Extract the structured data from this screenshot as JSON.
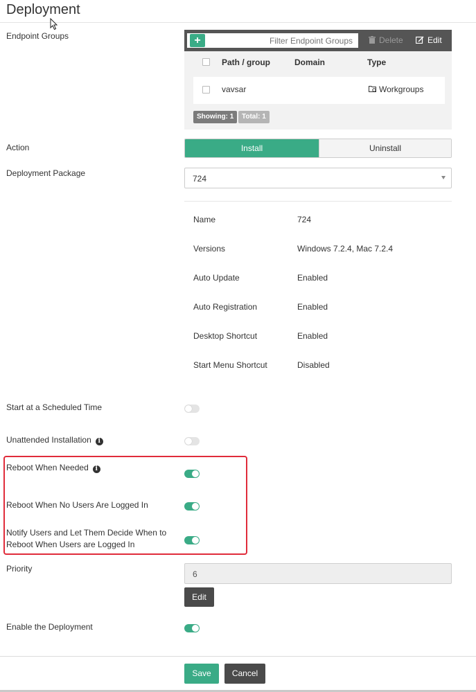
{
  "page": {
    "title": "Deployment"
  },
  "labels": {
    "endpoint_groups": "Endpoint Groups",
    "action": "Action",
    "deployment_package": "Deployment Package",
    "start_scheduled": "Start at a Scheduled Time",
    "unattended": "Unattended Installation",
    "reboot_needed": "Reboot When Needed",
    "reboot_no_users": "Reboot When No Users Are Logged In",
    "notify_line1": "Notify Users and Let Them Decide When to",
    "notify_line2": "Reboot When Users are Logged In",
    "priority": "Priority",
    "enable": "Enable the Deployment"
  },
  "endpoint_groups": {
    "add_label": "+",
    "filter_placeholder": "Filter Endpoint Groups",
    "delete_label": "Delete",
    "edit_label": "Edit",
    "columns": [
      "Path / group",
      "Domain",
      "Type"
    ],
    "rows": [
      {
        "path": "vavsar",
        "domain": "",
        "type": "Workgroups"
      }
    ],
    "showing": "Showing: 1",
    "total": "Total: 1"
  },
  "action": {
    "options": [
      "Install",
      "Uninstall"
    ],
    "selected": "Install"
  },
  "package": {
    "selected": "724",
    "details": [
      {
        "key": "Name",
        "value": "724"
      },
      {
        "key": "Versions",
        "value": "Windows 7.2.4, Mac 7.2.4"
      },
      {
        "key": "Auto Update",
        "value": "Enabled"
      },
      {
        "key": "Auto Registration",
        "value": "Enabled"
      },
      {
        "key": "Desktop Shortcut",
        "value": "Enabled"
      },
      {
        "key": "Start Menu Shortcut",
        "value": "Disabled"
      }
    ]
  },
  "toggles": {
    "start_scheduled": false,
    "unattended": false,
    "reboot_needed": true,
    "reboot_no_users": true,
    "notify_users": true,
    "enable": true
  },
  "priority": {
    "value": "6",
    "edit_label": "Edit"
  },
  "footer": {
    "save_label": "Save",
    "cancel_label": "Cancel"
  },
  "colors": {
    "accent": "#3aab86",
    "toolbar": "#555555",
    "highlight": "#e02b3a"
  }
}
